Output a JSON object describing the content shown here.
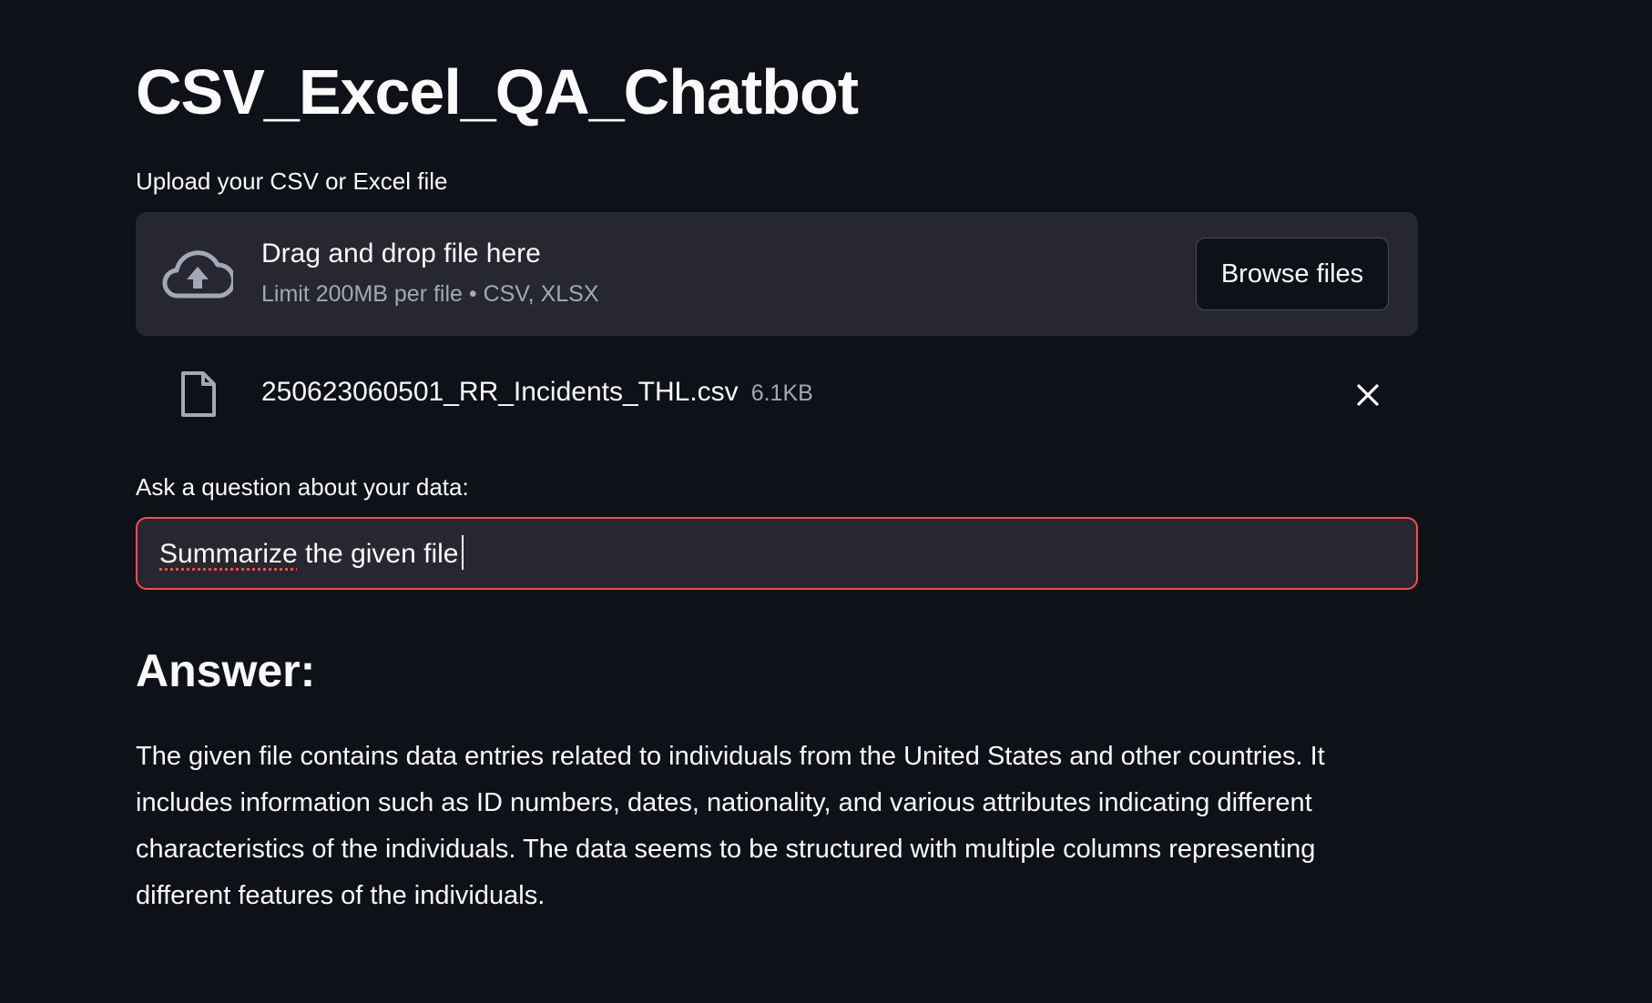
{
  "page": {
    "title": "CSV_Excel_QA_Chatbot"
  },
  "uploader": {
    "label": "Upload your CSV or Excel file",
    "drop_text": "Drag and drop file here",
    "limit_text": "Limit 200MB per file • CSV, XLSX",
    "browse_label": "Browse files",
    "icon": "cloud-upload-icon"
  },
  "uploaded_file": {
    "name": "250623060501_RR_Incidents_THL.csv",
    "size": "6.1KB",
    "icon": "file-icon",
    "remove_icon": "close-icon"
  },
  "question": {
    "label": "Ask a question about your data:",
    "value": "Summarize the given file",
    "misspelled_word": "Summarize",
    "rest": " the given file",
    "focus_color": "#ff4b4b"
  },
  "answer": {
    "heading": "Answer:",
    "text": "The given file contains data entries related to individuals from the United States and other countries. It includes information such as ID numbers, dates, nationality, and various attributes indicating different characteristics of the individuals. The data seems to be structured with multiple columns representing different features of the individuals."
  },
  "colors": {
    "background": "#0e1117",
    "surface": "#262730",
    "text": "#fafafa",
    "muted": "#a3a8b8",
    "accent": "#ff4b4b"
  }
}
